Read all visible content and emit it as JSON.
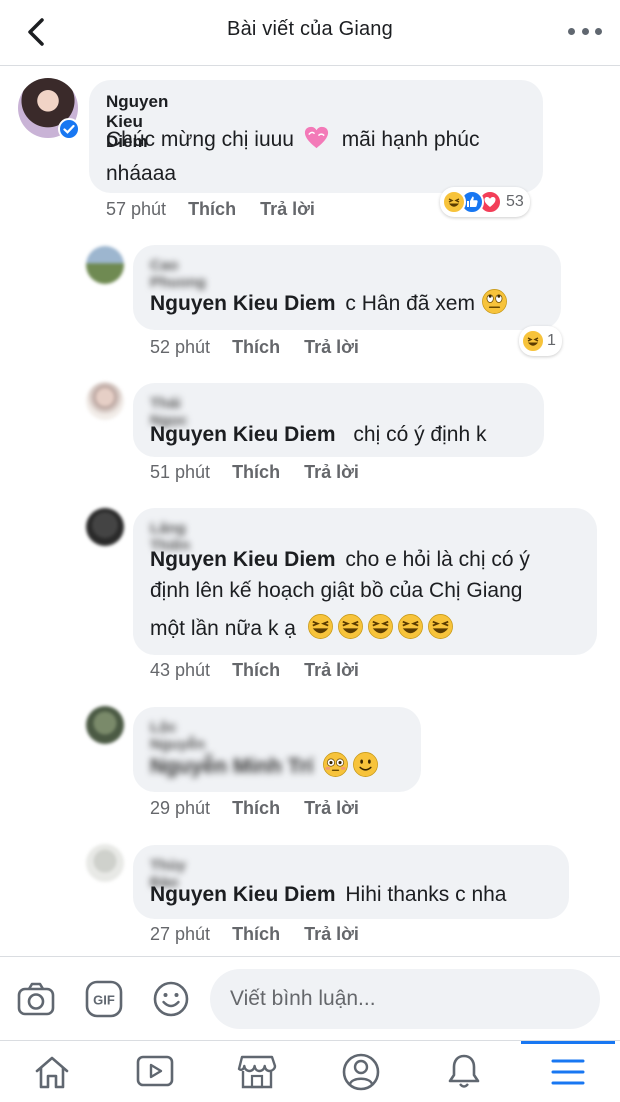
{
  "header": {
    "title": "Bài viết của Giang"
  },
  "comments": [
    {
      "name": "Nguyen Kieu Diem",
      "lines": [
        "Chúc mừng chị iuuu",
        "mãi hạnh phúc",
        "nháaaa"
      ],
      "time": "57 phút",
      "like_label": "Thích",
      "reply_label": "Trả lời",
      "reaction_count": "53"
    },
    {
      "name": "Cao Phuong",
      "tag": "Nguyen Kieu Diem",
      "text": "c Hân đã xem",
      "time": "52 phút",
      "like_label": "Thích",
      "reply_label": "Trả lời",
      "reaction_count": "1"
    },
    {
      "name": "Thái Ngọc",
      "tag": "Nguyen Kieu Diem",
      "text": "chị có ý định k",
      "time": "51 phút",
      "like_label": "Thích",
      "reply_label": "Trả lời"
    },
    {
      "name": "Lăng Thiên",
      "tag": "Nguyen Kieu Diem",
      "lines": [
        "cho e hỏi là chị có ý",
        "định lên kế hoạch giật bồ của Chị Giang",
        "một lần nữa k ạ"
      ],
      "time": "43 phút",
      "like_label": "Thích",
      "reply_label": "Trả lời"
    },
    {
      "name": "Lộc Nguyễn",
      "tag": "Nguyễn Minh Trí",
      "time": "29 phút",
      "like_label": "Thích",
      "reply_label": "Trả lời"
    },
    {
      "name": "Thùy Đào",
      "tag": "Nguyen Kieu Diem",
      "text": "Hihi thanks c nha",
      "time": "27 phút",
      "like_label": "Thích",
      "reply_label": "Trả lời"
    }
  ],
  "composer": {
    "placeholder": "Viết bình luận..."
  },
  "icons": {
    "back": "chevron-left-icon",
    "more": "more-icon",
    "camera": "camera-icon",
    "gif": "gif-icon",
    "smiley": "smiley-icon",
    "home": "home-icon",
    "video": "video-icon",
    "marketplace": "marketplace-icon",
    "profile": "profile-icon",
    "notifications": "bell-icon",
    "menu": "menu-icon"
  },
  "colors": {
    "accent": "#1877f2",
    "bubble": "#f0f2f5",
    "meta": "#65676b"
  }
}
